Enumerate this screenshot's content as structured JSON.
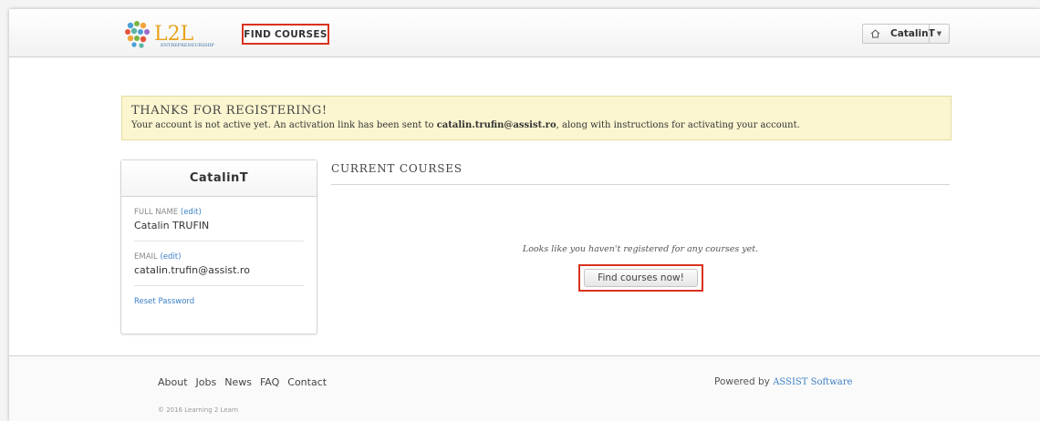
{
  "header": {
    "logo_text": "L2L",
    "logo_sub": "ENTREPRENEURSHIP",
    "nav_find_courses": "FIND COURSES",
    "user_name": "CatalinT",
    "icons": {
      "home": "home-icon",
      "caret": "caret-down-icon"
    }
  },
  "alert": {
    "title": "THANKS FOR REGISTERING!",
    "msg_before": "Your account is not active yet. An activation link has been sent to ",
    "email": "catalin.trufin@assist.ro",
    "msg_after": ", along with instructions for activating your account."
  },
  "profile": {
    "username": "CatalinT",
    "full_name_label": "FULL NAME",
    "edit_label": "(edit)",
    "full_name": "Catalin TRUFIN",
    "email_label": "EMAIL",
    "email": "catalin.trufin@assist.ro",
    "reset_password": "Reset Password"
  },
  "courses": {
    "title": "CURRENT COURSES",
    "empty_message": "Looks like you haven't registered for any courses yet.",
    "find_button": "Find courses now!"
  },
  "footer": {
    "links": [
      "About",
      "Jobs",
      "News",
      "FAQ",
      "Contact"
    ],
    "powered_by": "Powered by",
    "powered_brand": "ASSIST Software",
    "copyright": "© 2016 Learning 2 Learn"
  },
  "colors": {
    "accent_link": "#3b7fc4",
    "highlight_red": "#d8321e",
    "alert_bg": "#fbf6d0"
  }
}
